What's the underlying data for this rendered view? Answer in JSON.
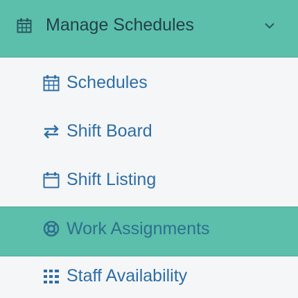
{
  "menu": {
    "header": {
      "label": "Manage Schedules",
      "icon": "calendar-icon",
      "chevron": "chevron-down-icon",
      "expanded": true
    },
    "items": [
      {
        "label": "Schedules",
        "icon": "calendar-grid-icon",
        "active": false
      },
      {
        "label": "Shift Board",
        "icon": "swap-arrows-icon",
        "active": false
      },
      {
        "label": "Shift Listing",
        "icon": "calendar-empty-icon",
        "active": false
      },
      {
        "label": "Work Assignments",
        "icon": "life-ring-icon",
        "active": true
      },
      {
        "label": "Staff Availability",
        "icon": "grid-dots-icon",
        "active": false
      }
    ]
  },
  "colors": {
    "header_bg": "#5bbfab",
    "active_bg": "#5bbfab",
    "link_text": "#2e6ea7",
    "header_text": "#23404a",
    "panel_bg": "#f5f6f8"
  }
}
